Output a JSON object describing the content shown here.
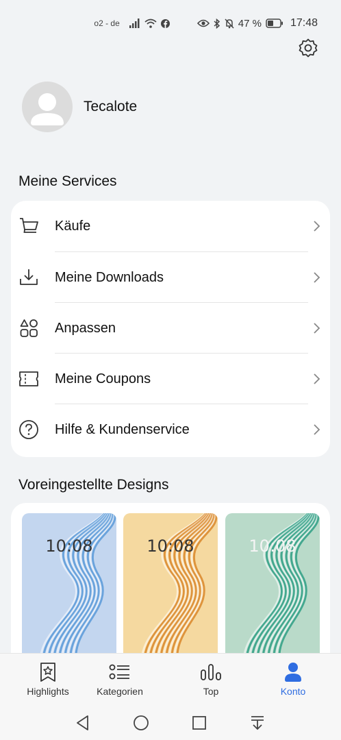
{
  "status_bar": {
    "carrier": "o2 - de",
    "battery": "47 %",
    "time": "17:48",
    "icons": [
      "signal-icon",
      "wifi-icon",
      "facebook-icon",
      "eye-icon",
      "bluetooth-icon",
      "mute-icon",
      "battery-icon"
    ]
  },
  "profile": {
    "username": "Tecalote"
  },
  "services": {
    "title": "Meine Services",
    "items": [
      {
        "label": "Käufe",
        "icon": "cart-icon"
      },
      {
        "label": "Meine Downloads",
        "icon": "download-icon"
      },
      {
        "label": "Anpassen",
        "icon": "customize-icon"
      },
      {
        "label": "Meine Coupons",
        "icon": "coupon-icon"
      },
      {
        "label": "Hilfe & Kundenservice",
        "icon": "help-icon"
      }
    ]
  },
  "designs": {
    "title": "Voreingestellte Designs",
    "themes": [
      {
        "clock": "10:08",
        "bg": "#c3d6ef",
        "accent": "#5a9ad8"
      },
      {
        "clock": "10:08",
        "bg": "#f5d9a0",
        "accent": "#d9872a"
      },
      {
        "clock": "10:08",
        "bg": "#b9dac9",
        "accent": "#2f9f85"
      }
    ]
  },
  "tabs": [
    {
      "label": "Highlights",
      "icon": "star-bookmark-icon",
      "active": false
    },
    {
      "label": "Kategorien",
      "icon": "list-icon",
      "active": false
    },
    {
      "label": "Top",
      "icon": "bar-chart-icon",
      "active": false
    },
    {
      "label": "Konto",
      "icon": "person-icon",
      "active": true
    }
  ],
  "colors": {
    "accent": "#2f6de1",
    "background": "#f1f3f5"
  }
}
